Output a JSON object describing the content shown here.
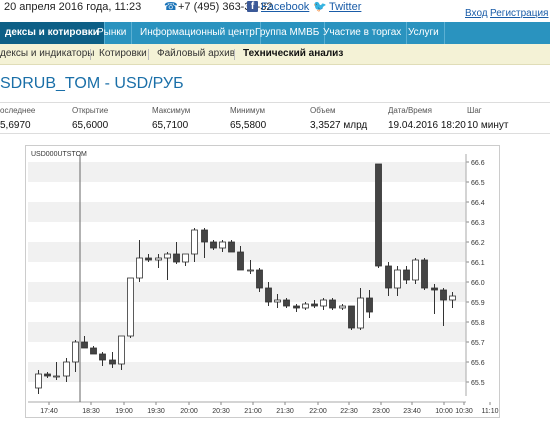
{
  "topbar": {
    "date": "20 апреля 2016 года, 11:23",
    "phone": "+7 (495) 363-32-32",
    "facebook": "Facebook",
    "twitter": "Twitter",
    "login": "Вход",
    "register": "Регистрация"
  },
  "main_nav": [
    "дексы и котировки",
    "Рынки",
    "Информационный центр",
    "Группа ММВБ",
    "Участие в торгах",
    "Услуги"
  ],
  "sub_nav": [
    "дексы и индикаторы",
    "Котировки",
    "Файловый архив",
    "Технический анализ"
  ],
  "title": "SDRUB_TOM - USD/РУБ",
  "stats": {
    "headers": [
      "оследнее",
      "Открытие",
      "Максимум",
      "Минимум",
      "Объем",
      "Дата/Время",
      "Шаг"
    ],
    "values": [
      "5,6970",
      "65,6000",
      "65,7100",
      "65,5800",
      "3,3527 млрд",
      "19.04.2016 18:20",
      "10 минут"
    ]
  },
  "colors": {
    "nav_bg": "#2a93bf",
    "nav_active": "#0d5f86",
    "subnav_bg": "#f4f2d6",
    "title": "#1a6fa8",
    "bull": "#ffffff",
    "bear": "#444444"
  },
  "chart_data": {
    "type": "candlestick",
    "instrument": "USD000UTSTOM",
    "x_ticks": [
      "17:40",
      "18:30",
      "19:00",
      "19:30",
      "20:00",
      "20:30",
      "21:00",
      "21:30",
      "22:00",
      "22:30",
      "23:00",
      "23:40",
      "10:00",
      "10:30",
      "11:10"
    ],
    "y_ticks": [
      "66.6",
      "66.5",
      "66.4",
      "66.3",
      "66.2",
      "66.1",
      "66.0",
      "65.9",
      "65.8",
      "65.7",
      "65.6",
      "65.5"
    ],
    "ylim": [
      65.43,
      66.62
    ],
    "grid": "alternating horizontal bands",
    "candles": [
      {
        "o": 65.47,
        "h": 65.56,
        "l": 65.44,
        "c": 65.54
      },
      {
        "o": 65.54,
        "h": 65.55,
        "l": 65.52,
        "c": 65.53
      },
      {
        "o": 65.53,
        "h": 65.6,
        "l": 65.51,
        "c": 65.53
      },
      {
        "o": 65.53,
        "h": 65.62,
        "l": 65.5,
        "c": 65.6
      },
      {
        "o": 65.6,
        "h": 65.71,
        "l": 65.55,
        "c": 65.7
      },
      {
        "o": 65.7,
        "h": 65.73,
        "l": 65.67,
        "c": 65.67
      },
      {
        "o": 65.67,
        "h": 65.68,
        "l": 65.64,
        "c": 65.64
      },
      {
        "o": 65.64,
        "h": 65.65,
        "l": 65.58,
        "c": 65.61
      },
      {
        "o": 65.61,
        "h": 65.65,
        "l": 65.57,
        "c": 65.59
      },
      {
        "o": 65.59,
        "h": 65.73,
        "l": 65.56,
        "c": 65.73
      },
      {
        "o": 65.73,
        "h": 66.02,
        "l": 65.72,
        "c": 66.02
      },
      {
        "o": 66.02,
        "h": 66.21,
        "l": 66.0,
        "c": 66.12
      },
      {
        "o": 66.12,
        "h": 66.14,
        "l": 66.1,
        "c": 66.11
      },
      {
        "o": 66.11,
        "h": 66.14,
        "l": 66.07,
        "c": 66.12
      },
      {
        "o": 66.12,
        "h": 66.15,
        "l": 66.01,
        "c": 66.14
      },
      {
        "o": 66.14,
        "h": 66.2,
        "l": 66.09,
        "c": 66.1
      },
      {
        "o": 66.1,
        "h": 66.14,
        "l": 66.08,
        "c": 66.14
      },
      {
        "o": 66.14,
        "h": 66.27,
        "l": 66.1,
        "c": 66.26
      },
      {
        "o": 66.26,
        "h": 66.27,
        "l": 66.12,
        "c": 66.2
      },
      {
        "o": 66.2,
        "h": 66.21,
        "l": 66.16,
        "c": 66.17
      },
      {
        "o": 66.17,
        "h": 66.21,
        "l": 66.15,
        "c": 66.2
      },
      {
        "o": 66.2,
        "h": 66.21,
        "l": 66.15,
        "c": 66.15
      },
      {
        "o": 66.15,
        "h": 66.18,
        "l": 66.06,
        "c": 66.06
      },
      {
        "o": 66.06,
        "h": 66.11,
        "l": 66.04,
        "c": 66.06
      },
      {
        "o": 66.06,
        "h": 66.07,
        "l": 65.95,
        "c": 65.97
      },
      {
        "o": 65.97,
        "h": 66.0,
        "l": 65.88,
        "c": 65.9
      },
      {
        "o": 65.9,
        "h": 65.94,
        "l": 65.87,
        "c": 65.91
      },
      {
        "o": 65.91,
        "h": 65.92,
        "l": 65.87,
        "c": 65.88
      },
      {
        "o": 65.88,
        "h": 65.89,
        "l": 65.85,
        "c": 65.87
      },
      {
        "o": 65.87,
        "h": 65.9,
        "l": 65.86,
        "c": 65.89
      },
      {
        "o": 65.89,
        "h": 65.91,
        "l": 65.87,
        "c": 65.88
      },
      {
        "o": 65.88,
        "h": 65.92,
        "l": 65.86,
        "c": 65.91
      },
      {
        "o": 65.91,
        "h": 65.92,
        "l": 65.86,
        "c": 65.87
      },
      {
        "o": 65.87,
        "h": 65.89,
        "l": 65.86,
        "c": 65.88
      },
      {
        "o": 65.88,
        "h": 65.88,
        "l": 65.76,
        "c": 65.77
      },
      {
        "o": 65.77,
        "h": 65.97,
        "l": 65.76,
        "c": 65.92
      },
      {
        "o": 65.92,
        "h": 65.96,
        "l": 65.82,
        "c": 65.85
      },
      {
        "o": 66.59,
        "h": 66.59,
        "l": 66.07,
        "c": 66.08
      },
      {
        "o": 66.08,
        "h": 66.1,
        "l": 65.93,
        "c": 65.97
      },
      {
        "o": 65.97,
        "h": 66.08,
        "l": 65.93,
        "c": 66.06
      },
      {
        "o": 66.06,
        "h": 66.08,
        "l": 65.99,
        "c": 66.01
      },
      {
        "o": 66.01,
        "h": 66.12,
        "l": 65.99,
        "c": 66.11
      },
      {
        "o": 66.11,
        "h": 66.12,
        "l": 65.96,
        "c": 65.97
      },
      {
        "o": 65.97,
        "h": 65.99,
        "l": 65.84,
        "c": 65.96
      },
      {
        "o": 65.96,
        "h": 65.97,
        "l": 65.78,
        "c": 65.91
      },
      {
        "o": 65.91,
        "h": 65.95,
        "l": 65.87,
        "c": 65.93
      }
    ]
  }
}
